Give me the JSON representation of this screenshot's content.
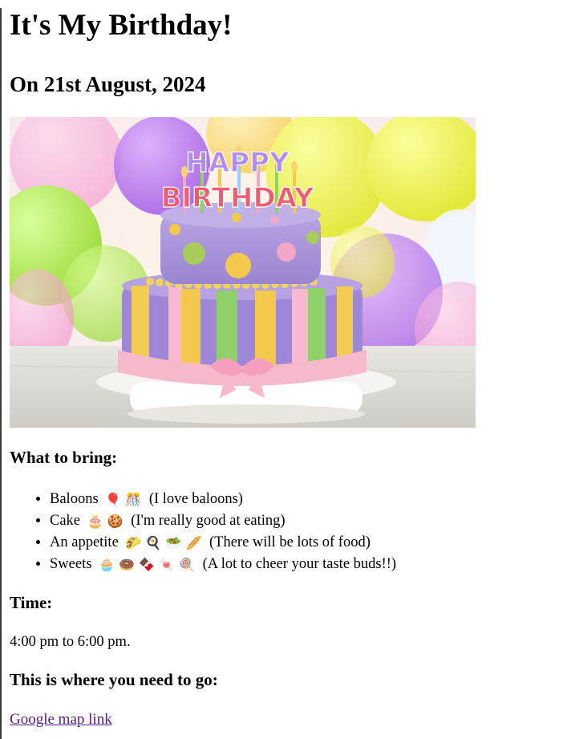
{
  "page": {
    "title": "It's My Birthday!",
    "date": "On 21st August, 2024"
  },
  "image": {
    "icon": "birthday-cake-image",
    "cake_topper_line1": "HAPPY",
    "cake_topper_line2": "BIRTHDAY"
  },
  "bring": {
    "heading": "What to bring:",
    "items": [
      {
        "label": "Baloons",
        "emoji": "🎈 🎊",
        "note": "(I love baloons)"
      },
      {
        "label": "Cake",
        "emoji": "🎂 🍪",
        "note": "(I'm really good at eating)"
      },
      {
        "label": "An appetite",
        "emoji": "🌮 🍳 🥗 🥖",
        "note": "(There will be lots of food)"
      },
      {
        "label": "Sweets",
        "emoji": "🧁 🍩 🍫 🍬 🍭",
        "note": "(A lot to cheer your taste buds!!)"
      }
    ]
  },
  "time": {
    "heading": "Time:",
    "text": "4:00 pm to 6:00 pm."
  },
  "location": {
    "heading": "This is where you need to go:",
    "link_text": "Google map link"
  },
  "colors": {
    "link_visited": "#551a8b",
    "cake_purple": "#9b82cf",
    "ribbon_pink": "#f6b9cc"
  }
}
